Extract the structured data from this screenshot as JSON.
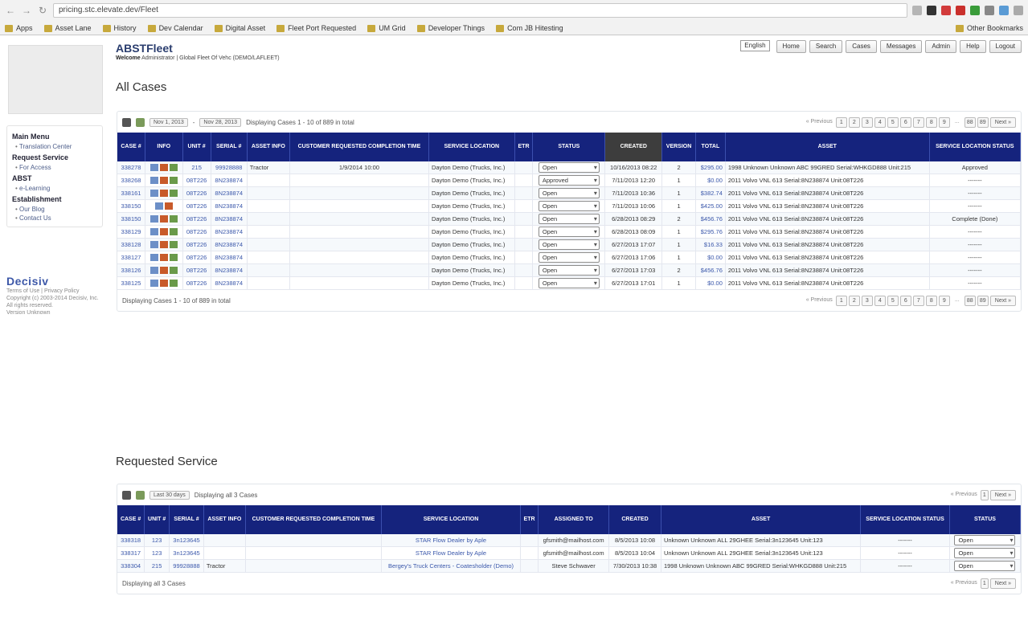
{
  "browser": {
    "url": "pricing.stc.elevate.dev/Fleet",
    "bookmarks": [
      "Apps",
      "Asset Lane",
      "History",
      "Dev Calendar",
      "Digital Asset",
      "Fleet Port Requested",
      "UM Grid",
      "Developer Things",
      "Com JB Hitesting"
    ],
    "other_bookmarks": "Other Bookmarks"
  },
  "header": {
    "title": "ABSTFleet",
    "welcome_label": "Welcome",
    "welcome_text": "Administrator | Global Fleet Of Vehc (DEMO/LAFLEET)",
    "language": "English",
    "buttons": [
      "Home",
      "Search",
      "Cases",
      "Messages",
      "Admin",
      "Help",
      "Logout"
    ]
  },
  "sidebar": {
    "sections": [
      {
        "title": "Main Menu",
        "items": [
          "Translation Center"
        ]
      },
      {
        "title": "Request Service",
        "items": [
          "For Access"
        ]
      },
      {
        "title": "ABST",
        "items": [
          "e-Learning"
        ]
      },
      {
        "title": "Establishment",
        "items": [
          "Our Blog",
          "Contact Us"
        ]
      }
    ],
    "brand": "Decisiv",
    "brand_links": "Terms of Use  |  Privacy Policy",
    "brand_copy": "Copyright (c) 2003-2014 Decisiv, Inc. All rights reserved.",
    "brand_version": "Version Unknown"
  },
  "all_cases": {
    "title": "All Cases",
    "date_from": "Nov 1, 2013",
    "date_to": "Nov 28, 2013",
    "displaying": "Displaying Cases 1 - 10 of 889 in total",
    "footer_displaying": "Displaying Cases 1 - 10 of 889 in total",
    "pager": {
      "prev": "« Previous",
      "pages": [
        "1",
        "2",
        "3",
        "4",
        "5",
        "6",
        "7",
        "8",
        "9"
      ],
      "ellipsis": "...",
      "last_pages": [
        "88",
        "89"
      ],
      "next": "Next »"
    },
    "columns": [
      "Case #",
      "Info",
      "Unit #",
      "Serial #",
      "Asset Info",
      "Customer Requested Completion Time",
      "Service Location",
      "ETR",
      "Status",
      "Created",
      "Version",
      "Total",
      "Asset",
      "Service Location Status"
    ],
    "rows": [
      {
        "case": "338278",
        "unit": "215",
        "serial": "99928888",
        "asset_info": "Tractor",
        "req_time": "1/9/2014 10:00",
        "location": "Dayton Demo (Trucks, Inc.)",
        "etr": "",
        "status": "Open",
        "created": "10/16/2013 08:22",
        "version": "2",
        "total": "$295.00",
        "asset": "1998 Unknown Unknown ABC 99GRED Serial:WHKGD888 Unit:215",
        "sl_status": "Approved",
        "icons": 3
      },
      {
        "case": "338268",
        "unit": "08T226",
        "serial": "8N238874",
        "asset_info": "",
        "req_time": "",
        "location": "Dayton Demo (Trucks, Inc.)",
        "etr": "",
        "status": "Approved",
        "created": "7/11/2013 12:20",
        "version": "1",
        "total": "$0.00",
        "asset": "2011 Volvo VNL 613 Serial:8N238874 Unit:08T226",
        "sl_status": "-------",
        "icons": 3
      },
      {
        "case": "338161",
        "unit": "08T226",
        "serial": "8N238874",
        "asset_info": "",
        "req_time": "",
        "location": "Dayton Demo (Trucks, Inc.)",
        "etr": "",
        "status": "Open",
        "created": "7/11/2013 10:36",
        "version": "1",
        "total": "$382.74",
        "asset": "2011 Volvo VNL 613 Serial:8N238874 Unit:08T226",
        "sl_status": "-------",
        "icons": 3
      },
      {
        "case": "338150",
        "unit": "08T226",
        "serial": "8N238874",
        "asset_info": "",
        "req_time": "",
        "location": "Dayton Demo (Trucks, Inc.)",
        "etr": "",
        "status": "Open",
        "created": "7/11/2013 10:06",
        "version": "1",
        "total": "$425.00",
        "asset": "2011 Volvo VNL 613 Serial:8N238874 Unit:08T226",
        "sl_status": "-------",
        "icons": 2
      },
      {
        "case": "338150",
        "unit": "08T226",
        "serial": "8N238874",
        "asset_info": "",
        "req_time": "",
        "location": "Dayton Demo (Trucks, Inc.)",
        "etr": "",
        "status": "Open",
        "created": "6/28/2013 08:29",
        "version": "2",
        "total": "$456.76",
        "asset": "2011 Volvo VNL 613 Serial:8N238874 Unit:08T226",
        "sl_status": "Complete (Done)",
        "icons": 3
      },
      {
        "case": "338129",
        "unit": "08T226",
        "serial": "8N238874",
        "asset_info": "",
        "req_time": "",
        "location": "Dayton Demo (Trucks, Inc.)",
        "etr": "",
        "status": "Open",
        "created": "6/28/2013 08:09",
        "version": "1",
        "total": "$295.76",
        "asset": "2011 Volvo VNL 613 Serial:8N238874 Unit:08T226",
        "sl_status": "-------",
        "icons": 3
      },
      {
        "case": "338128",
        "unit": "08T226",
        "serial": "8N238874",
        "asset_info": "",
        "req_time": "",
        "location": "Dayton Demo (Trucks, Inc.)",
        "etr": "",
        "status": "Open",
        "created": "6/27/2013 17:07",
        "version": "1",
        "total": "$16.33",
        "asset": "2011 Volvo VNL 613 Serial:8N238874 Unit:08T226",
        "sl_status": "-------",
        "icons": 3
      },
      {
        "case": "338127",
        "unit": "08T226",
        "serial": "8N238874",
        "asset_info": "",
        "req_time": "",
        "location": "Dayton Demo (Trucks, Inc.)",
        "etr": "",
        "status": "Open",
        "created": "6/27/2013 17:06",
        "version": "1",
        "total": "$0.00",
        "asset": "2011 Volvo VNL 613 Serial:8N238874 Unit:08T226",
        "sl_status": "-------",
        "icons": 3
      },
      {
        "case": "338126",
        "unit": "08T226",
        "serial": "8N238874",
        "asset_info": "",
        "req_time": "",
        "location": "Dayton Demo (Trucks, Inc.)",
        "etr": "",
        "status": "Open",
        "created": "6/27/2013 17:03",
        "version": "2",
        "total": "$456.76",
        "asset": "2011 Volvo VNL 613 Serial:8N238874 Unit:08T226",
        "sl_status": "-------",
        "icons": 3
      },
      {
        "case": "338125",
        "unit": "08T226",
        "serial": "8N238874",
        "asset_info": "",
        "req_time": "",
        "location": "Dayton Demo (Trucks, Inc.)",
        "etr": "",
        "status": "Open",
        "created": "6/27/2013 17:01",
        "version": "1",
        "total": "$0.00",
        "asset": "2011 Volvo VNL 613 Serial:8N238874 Unit:08T226",
        "sl_status": "-------",
        "icons": 3
      }
    ]
  },
  "requested": {
    "title": "Requested Service",
    "date_btn": "Last 30 days",
    "displaying": "Displaying all 3 Cases",
    "footer_displaying": "Displaying all 3 Cases",
    "pager": {
      "prev": "« Previous",
      "page": "1",
      "next": "Next »"
    },
    "columns": [
      "Case #",
      "Unit #",
      "Serial #",
      "Asset Info",
      "Customer Requested Completion Time",
      "Service Location",
      "ETR",
      "Assigned To",
      "Created",
      "Asset",
      "Service Location Status",
      "Status"
    ],
    "rows": [
      {
        "case": "338318",
        "unit": "123",
        "serial": "3n123645",
        "asset_info": "",
        "req_time": "",
        "location": "STAR Flow Dealer by Aple",
        "etr": "",
        "assigned": "gfsmith@mailhost.com",
        "created": "8/5/2013 10:08",
        "asset": "Unknown Unknown ALL 29GHEE Serial:3n123645 Unit:123",
        "sl_status": "-------",
        "status": "Open"
      },
      {
        "case": "338317",
        "unit": "123",
        "serial": "3n123645",
        "asset_info": "",
        "req_time": "",
        "location": "STAR Flow Dealer by Aple",
        "etr": "",
        "assigned": "gfsmith@mailhost.com",
        "created": "8/5/2013 10:04",
        "asset": "Unknown Unknown ALL 29GHEE Serial:3n123645 Unit:123",
        "sl_status": "-------",
        "status": "Open"
      },
      {
        "case": "338304",
        "unit": "215",
        "serial": "99928888",
        "asset_info": "Tractor",
        "req_time": "",
        "location": "Bergey's Truck Centers - Coatesholder (Demo)",
        "etr": "",
        "assigned": "Steve Schwaver",
        "created": "7/30/2013 10:38",
        "asset": "1998 Unknown Unknown ABC 99GRED Serial:WHKGD888 Unit:215",
        "sl_status": "-------",
        "status": "Open"
      }
    ]
  }
}
